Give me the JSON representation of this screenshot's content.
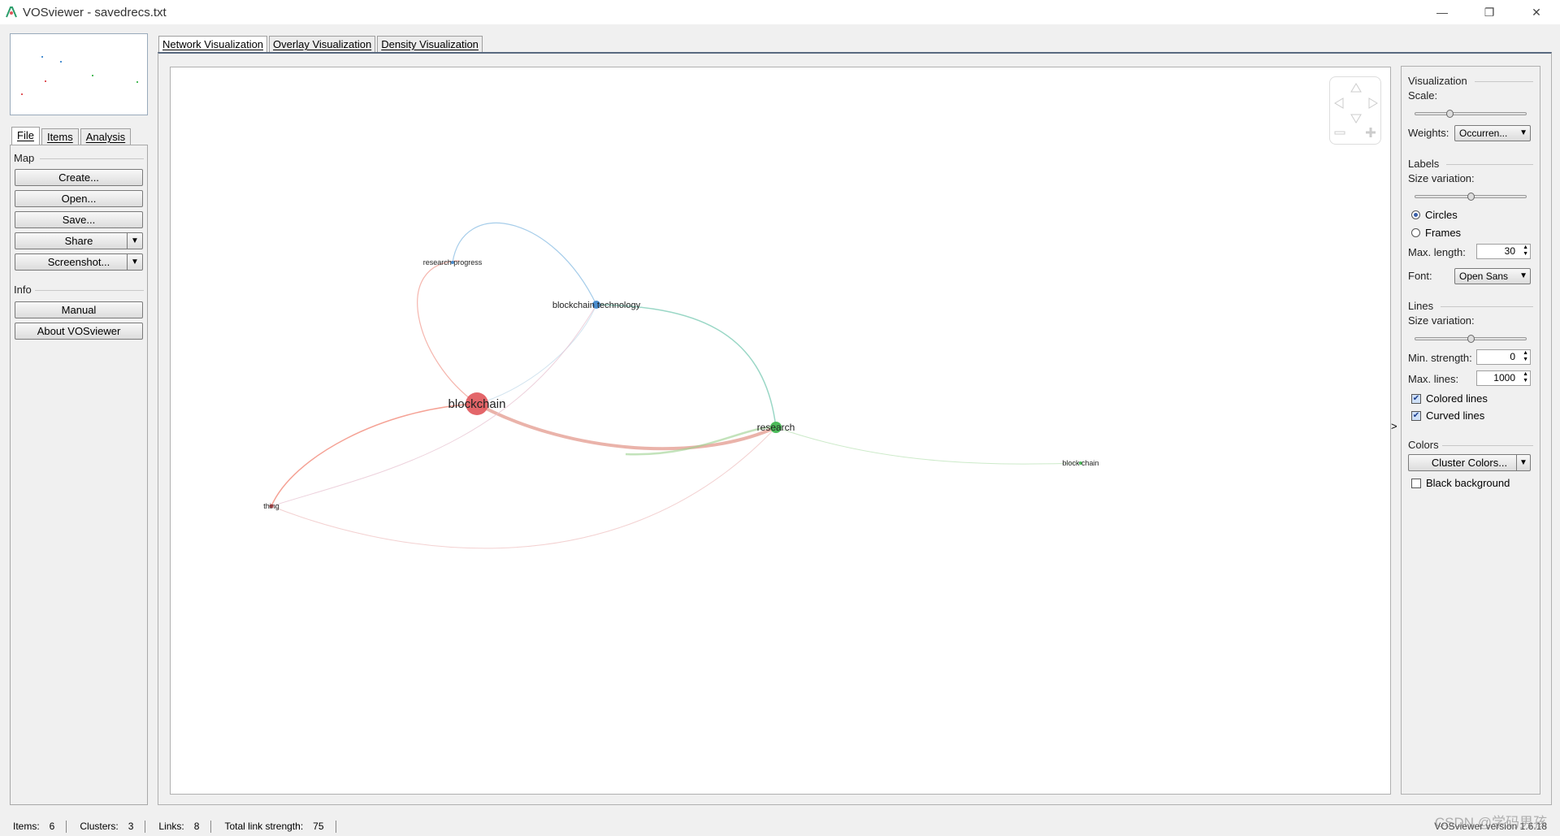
{
  "window": {
    "title": "VOSviewer - savedrecs.txt",
    "controls": {
      "minimize": "—",
      "restore": "❐",
      "close": "✕"
    }
  },
  "left_tabs": [
    {
      "label": "File",
      "active": true
    },
    {
      "label": "Items",
      "active": false
    },
    {
      "label": "Analysis",
      "active": false
    }
  ],
  "file_panel": {
    "map_section": "Map",
    "create": "Create...",
    "open": "Open...",
    "save": "Save...",
    "share": "Share",
    "screenshot": "Screenshot...",
    "info_section": "Info",
    "manual": "Manual",
    "about": "About VOSviewer"
  },
  "main_tabs": [
    {
      "label": "Network Visualization",
      "active": true
    },
    {
      "label": "Overlay Visualization",
      "active": false
    },
    {
      "label": "Density Visualization",
      "active": false
    }
  ],
  "network": {
    "nodes": [
      {
        "label": "blockchain",
        "cluster": "red",
        "color": "#e0555a",
        "size": "large"
      },
      {
        "label": "thing",
        "cluster": "red",
        "color": "#e0555a",
        "size": "small"
      },
      {
        "label": "blockchain technology",
        "cluster": "blue",
        "color": "#4b8fd1",
        "size": "medium"
      },
      {
        "label": "research progress",
        "cluster": "blue",
        "color": "#4b8fd1",
        "size": "small"
      },
      {
        "label": "research",
        "cluster": "green",
        "color": "#4cbb5a",
        "size": "medium"
      },
      {
        "label": "block chain",
        "cluster": "green",
        "color": "#4cbb5a",
        "size": "small"
      }
    ]
  },
  "collapse_arrow": ">",
  "right_panel": {
    "visualization_section": "Visualization",
    "scale_label": "Scale:",
    "scale_value": 0.3,
    "weights_label": "Weights:",
    "weights_value": "Occurren...",
    "labels_section": "Labels",
    "label_size_variation_label": "Size variation:",
    "label_size_variation_value": 0.5,
    "circles": "Circles",
    "frames": "Frames",
    "label_shape_selected": "Circles",
    "max_length_label": "Max. length:",
    "max_length_value": "30",
    "font_label": "Font:",
    "font_value": "Open Sans",
    "lines_section": "Lines",
    "line_size_variation_label": "Size variation:",
    "line_size_variation_value": 0.5,
    "min_strength_label": "Min. strength:",
    "min_strength_value": "0",
    "max_lines_label": "Max. lines:",
    "max_lines_value": "1000",
    "colored_lines": "Colored lines",
    "colored_lines_checked": true,
    "curved_lines": "Curved lines",
    "curved_lines_checked": true,
    "colors_section": "Colors",
    "cluster_colors": "Cluster Colors...",
    "black_background": "Black background",
    "black_background_checked": false
  },
  "status": {
    "items_label": "Items:",
    "items_value": "6",
    "clusters_label": "Clusters:",
    "clusters_value": "3",
    "links_label": "Links:",
    "links_value": "8",
    "strength_label": "Total link strength:",
    "strength_value": "75",
    "version": "VOSviewer version 1.6.18"
  },
  "watermark": "CSDN @学码男孩"
}
